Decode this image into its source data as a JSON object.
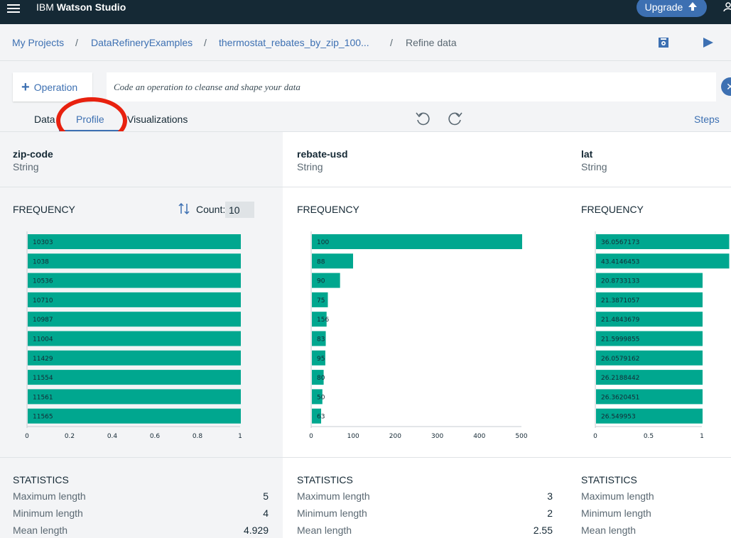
{
  "topbar": {
    "brand_prefix": "IBM",
    "brand_name": "Watson Studio",
    "upgrade_label": "Upgrade"
  },
  "breadcrumb": {
    "items": [
      "My Projects",
      "DataRefineryExamples",
      "thermostat_rebates_by_zip_100...",
      "Refine data"
    ],
    "separator": "/"
  },
  "toolbar": {
    "operation_label": "Operation",
    "command_placeholder": "Code an operation to cleanse and shape your data"
  },
  "tabs": [
    "Data",
    "Profile",
    "Visualizations"
  ],
  "active_tab": "Profile",
  "steps_label": "Steps",
  "frequency_label": "FREQUENCY",
  "count_label": "Count:",
  "count_value": "10",
  "statistics_label": "STATISTICS",
  "stat_labels": [
    "Maximum length",
    "Minimum length",
    "Mean length"
  ],
  "columns": [
    {
      "name": "zip-code",
      "type": "String",
      "stats": [
        "5",
        "4",
        "4.929"
      ]
    },
    {
      "name": "rebate-usd",
      "type": "String",
      "stats": [
        "3",
        "2",
        "2.55"
      ]
    },
    {
      "name": "lat",
      "type": "String",
      "stats": [
        "",
        "",
        ""
      ]
    }
  ],
  "colors": {
    "bar": "#00a78f",
    "accent": "#3d70b2",
    "topbar": "#152935",
    "annotation": "#e8210f"
  },
  "chart_data": [
    {
      "type": "bar",
      "orientation": "horizontal",
      "title": "zip-code",
      "categories": [
        "10303",
        "1038",
        "10536",
        "10710",
        "10987",
        "11004",
        "11429",
        "11554",
        "11561",
        "11565"
      ],
      "values": [
        1,
        1,
        1,
        1,
        1,
        1,
        1,
        1,
        1,
        1
      ],
      "xlim": [
        0,
        1
      ],
      "xticks": [
        "0",
        "0.2",
        "0.4",
        "0.6",
        "0.8",
        "1"
      ]
    },
    {
      "type": "bar",
      "orientation": "horizontal",
      "title": "rebate-usd",
      "categories": [
        "100",
        "88",
        "90",
        "75",
        "156",
        "83",
        "95",
        "80",
        "50",
        "63"
      ],
      "values": [
        500,
        98,
        67,
        38,
        35,
        33,
        32,
        28,
        25,
        22
      ],
      "xlim": [
        0,
        500
      ],
      "xticks": [
        "0",
        "100",
        "200",
        "300",
        "400",
        "500"
      ]
    },
    {
      "type": "bar",
      "orientation": "horizontal",
      "title": "lat",
      "categories": [
        "36.0567173",
        "43.4146453",
        "20.8733133",
        "21.3871057",
        "21.4843679",
        "21.5999855",
        "26.0579162",
        "26.2188442",
        "26.3620451",
        "26.549953"
      ],
      "values": [
        1.25,
        1.25,
        1,
        1,
        1,
        1,
        1,
        1,
        1,
        1
      ],
      "xlim": [
        0,
        1
      ],
      "xticks": [
        "0",
        "0.5",
        "1"
      ]
    }
  ]
}
